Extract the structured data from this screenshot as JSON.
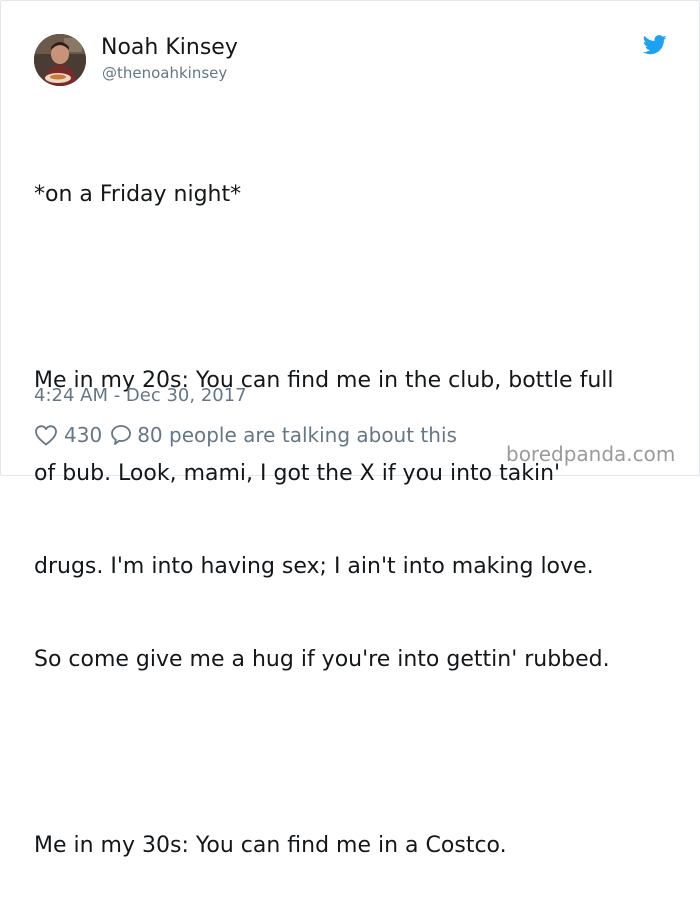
{
  "tweet": {
    "author": {
      "display_name": "Noah Kinsey",
      "handle": "@thenoahkinsey"
    },
    "platform_icon": "twitter-bird-icon",
    "text_lines": [
      "*on a Friday night*",
      "",
      "Me in my 20s: You can find me in the club, bottle full",
      "of bub. Look, mami, I got the X if you into takin'",
      "drugs. I'm into having sex; I ain't into making love.",
      "So come give me a hug if you're into gettin' rubbed.",
      "",
      "Me in my 30s: You can find me in a Costco."
    ],
    "timestamp": "4:24 AM - Dec 30, 2017",
    "likes": "430",
    "replies_text": "80 people are talking about this"
  },
  "watermark": "boredpanda.com",
  "colors": {
    "text_primary": "#14171a",
    "text_secondary": "#657786",
    "twitter_blue": "#1da1f2",
    "watermark": "#9a9a9a",
    "border": "#e1e8ed"
  },
  "icons": {
    "like": "heart-outline-icon",
    "reply": "speech-bubble-icon",
    "brand": "twitter-bird-icon"
  }
}
